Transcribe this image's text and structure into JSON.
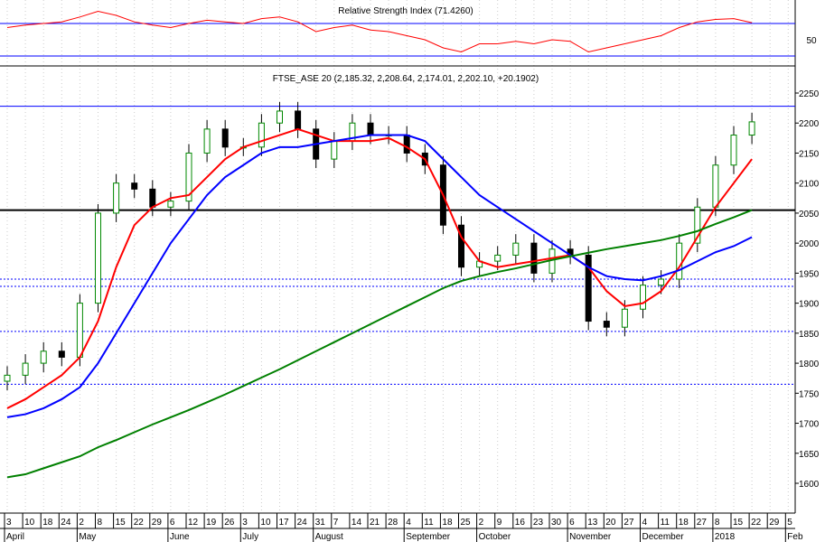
{
  "chart_data": {
    "type": "candlestick",
    "title": "FTSE_ASE 20 (2,185.32, 2,208.64, 2,174.01, 2,202.10, +20.1902)",
    "rsi": {
      "title": "Relative Strength Index (71.4260)",
      "ylim": [
        10,
        90
      ],
      "levels": [
        70,
        30
      ],
      "tick_labels": [
        "50"
      ],
      "values": [
        65,
        68,
        70,
        72,
        78,
        85,
        80,
        72,
        68,
        65,
        70,
        74,
        72,
        70,
        76,
        78,
        72,
        60,
        65,
        68,
        62,
        60,
        55,
        50,
        40,
        35,
        45,
        45,
        48,
        45,
        50,
        48,
        35,
        40,
        45,
        50,
        55,
        65,
        72,
        75,
        76,
        71
      ]
    },
    "ylim": [
      1575,
      2275
    ],
    "y_ticks": [
      "2250",
      "2200",
      "2150",
      "2100",
      "2050",
      "2000",
      "1950",
      "1900",
      "1850",
      "1800",
      "1750",
      "1700",
      "1650",
      "1600"
    ],
    "x_ticks": [
      "3",
      "10",
      "18",
      "24",
      "2",
      "8",
      "15",
      "22",
      "29",
      "6",
      "12",
      "19",
      "26",
      "3",
      "10",
      "17",
      "24",
      "31",
      "7",
      "14",
      "21",
      "28",
      "4",
      "11",
      "18",
      "25",
      "2",
      "9",
      "16",
      "23",
      "30",
      "6",
      "13",
      "20",
      "27",
      "4",
      "11",
      "18",
      "27",
      "8",
      "15",
      "22",
      "29",
      "5"
    ],
    "months": [
      {
        "label": "April",
        "tick": 0
      },
      {
        "label": "May",
        "tick": 4
      },
      {
        "label": "June",
        "tick": 9
      },
      {
        "label": "July",
        "tick": 13
      },
      {
        "label": "August",
        "tick": 17
      },
      {
        "label": "September",
        "tick": 22
      },
      {
        "label": "October",
        "tick": 26
      },
      {
        "label": "November",
        "tick": 31
      },
      {
        "label": "December",
        "tick": 35
      },
      {
        "label": "2018",
        "tick": 39
      },
      {
        "label": "Feb",
        "tick": 43
      }
    ],
    "close": [
      1780,
      1800,
      1820,
      1810,
      1900,
      2050,
      2100,
      2090,
      2060,
      2070,
      2150,
      2190,
      2160,
      2160,
      2200,
      2220,
      2190,
      2140,
      2170,
      2200,
      2180,
      2180,
      2150,
      2130,
      2030,
      1960,
      1970,
      1980,
      2000,
      1950,
      1990,
      1980,
      1870,
      1860,
      1890,
      1930,
      1940,
      2000,
      2060,
      2130,
      2180,
      2202
    ],
    "series": [
      {
        "name": "MA short",
        "color": "#ff0000",
        "values": [
          1725,
          1740,
          1760,
          1780,
          1810,
          1870,
          1960,
          2030,
          2060,
          2075,
          2080,
          2110,
          2140,
          2160,
          2170,
          2180,
          2190,
          2180,
          2170,
          2170,
          2170,
          2175,
          2160,
          2140,
          2080,
          2010,
          1970,
          1960,
          1965,
          1970,
          1975,
          1980,
          1960,
          1920,
          1895,
          1900,
          1920,
          1960,
          2010,
          2060,
          2100,
          2140
        ]
      },
      {
        "name": "MA medium",
        "color": "#0000ff",
        "values": [
          1710,
          1715,
          1725,
          1740,
          1760,
          1800,
          1850,
          1900,
          1950,
          2000,
          2040,
          2080,
          2110,
          2130,
          2150,
          2160,
          2160,
          2165,
          2170,
          2175,
          2180,
          2180,
          2180,
          2170,
          2140,
          2110,
          2080,
          2060,
          2040,
          2020,
          2000,
          1980,
          1960,
          1945,
          1940,
          1938,
          1945,
          1955,
          1970,
          1985,
          1995,
          2010
        ]
      },
      {
        "name": "MA long",
        "color": "#008000",
        "values": [
          1610,
          1615,
          1625,
          1635,
          1645,
          1660,
          1672,
          1685,
          1698,
          1710,
          1722,
          1735,
          1748,
          1762,
          1776,
          1790,
          1805,
          1820,
          1835,
          1850,
          1865,
          1880,
          1895,
          1910,
          1925,
          1937,
          1945,
          1952,
          1958,
          1965,
          1972,
          1978,
          1984,
          1990,
          1995,
          2000,
          2005,
          2012,
          2020,
          2032,
          2043,
          2055
        ]
      }
    ],
    "hlines": [
      {
        "value": 2228,
        "color": "#0000ff",
        "style": "solid"
      },
      {
        "value": 2055,
        "color": "#000000",
        "style": "solid"
      },
      {
        "value": 1940,
        "color": "#0000ff",
        "style": "dotted"
      },
      {
        "value": 1928,
        "color": "#0000ff",
        "style": "dotted"
      },
      {
        "value": 1853,
        "color": "#0000ff",
        "style": "dotted"
      },
      {
        "value": 1765,
        "color": "#0000ff",
        "style": "dotted"
      }
    ]
  }
}
